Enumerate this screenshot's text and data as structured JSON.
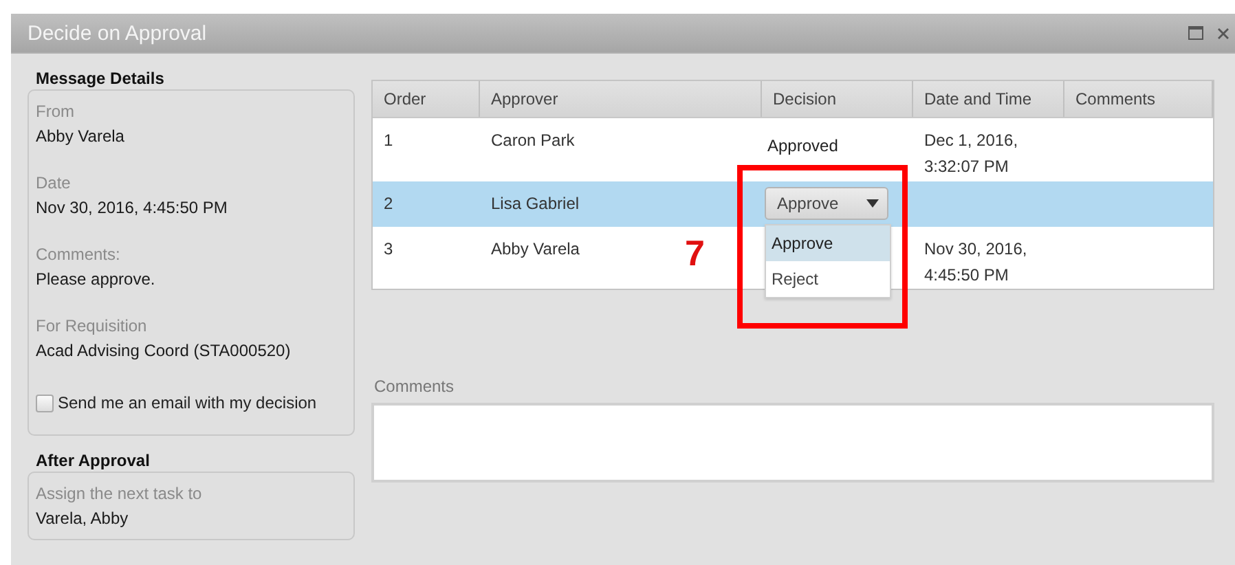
{
  "window": {
    "title": "Decide on Approval"
  },
  "message_details": {
    "heading": "Message Details",
    "fields": [
      {
        "label": "From",
        "value": "Abby Varela"
      },
      {
        "label": "Date",
        "value": "Nov 30, 2016, 4:45:50 PM"
      },
      {
        "label": "Comments:",
        "value": "Please approve."
      },
      {
        "label": "For Requisition",
        "value": "Acad Advising Coord (STA000520)"
      }
    ],
    "email_checkbox": {
      "label": "Send me an email with my decision",
      "checked": false
    }
  },
  "after_approval": {
    "heading": "After Approval",
    "fields": [
      {
        "label": "Assign the next task to",
        "value": "Varela, Abby"
      }
    ]
  },
  "table": {
    "columns": [
      "Order",
      "Approver",
      "Decision",
      "Date and Time",
      "Comments"
    ],
    "rows": [
      {
        "order": "1",
        "approver": "Caron Park",
        "decision": {
          "kind": "text",
          "text": "Approved"
        },
        "date_time": "Dec 1, 2016, 3:32:07 PM",
        "selected": false
      },
      {
        "order": "2",
        "approver": "Lisa Gabriel",
        "decision": {
          "kind": "dropdown",
          "value": "Approve",
          "expanded": true,
          "options": [
            {
              "label": "Approve",
              "selected": true
            },
            {
              "label": "Reject",
              "selected": false
            }
          ]
        },
        "selected": true
      },
      {
        "order": "3",
        "approver": "Abby Varela",
        "date_time": "Nov 30, 2016, 4:45:50 PM",
        "selected": false
      }
    ]
  },
  "annotation": {
    "number": "7"
  },
  "comments": {
    "label": "Comments"
  }
}
